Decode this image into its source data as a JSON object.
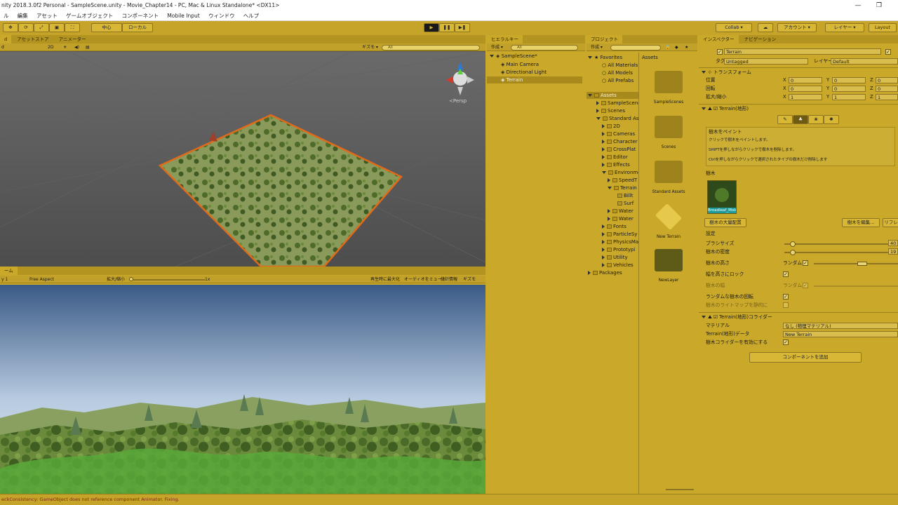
{
  "window": {
    "title": "nity 2018.3.0f2 Personal - SampleScene.unity - Movie_Chapter14 - PC, Mac & Linux Standalone* <DX11>",
    "minimize": "—",
    "restore": "❐"
  },
  "menu": [
    "ル",
    "編集",
    "アセット",
    "ゲームオブジェクト",
    "コンポーネント",
    "Mobile Input",
    "ウィンドウ",
    "ヘルプ"
  ],
  "toolbar": {
    "pivot": "中心",
    "space": "ローカル",
    "collab": "Collab ▾",
    "account": "アカウント ▾",
    "layers": "レイヤー ▾",
    "layout": "Layout"
  },
  "scene": {
    "tabs": [
      "d",
      "アセットストア",
      "アニメーター"
    ],
    "shaded": "d",
    "mode2d": "2D",
    "gizmos": "ギズモ ▾",
    "search": "All",
    "persp": "≺Persp"
  },
  "game": {
    "tab": "ーム",
    "display": "y 1",
    "aspect": "Free Aspect",
    "scale_label": "拡大/縮小",
    "scale_value": "1x",
    "maximize": "再生時に最大化",
    "mute": "オーディオをミュート",
    "stats": "統計情報",
    "gizmos": "ギズモ"
  },
  "hierarchy": {
    "tab": "ヒエラルキー",
    "create": "作成 ▾",
    "search": "All",
    "scene": "SampleScene*",
    "items": [
      "Main Camera",
      "Directional Light",
      "Terrain"
    ]
  },
  "project": {
    "tab": "プロジェクト",
    "create": "作成 ▾",
    "favorites": "Favorites",
    "fav_items": [
      "All Materials",
      "All Models",
      "All Prefabs"
    ],
    "assets_root": "Assets",
    "tree": [
      "SampleScene",
      "Scenes",
      "Standard As",
      "2D",
      "Cameras",
      "Character",
      "CrossPlat",
      "Editor",
      "Effects",
      "Environme",
      "SpeedT",
      "Terrain",
      "Billt",
      "Surf",
      "Water",
      "Water",
      "Fonts",
      "ParticleSy",
      "PhysicsMa",
      "Prototypi",
      "Utility",
      "Vehicles"
    ],
    "packages": "Packages",
    "breadcrumb": "Assets",
    "assets": [
      "SampleScenes",
      "Scenes",
      "Standard Assets",
      "New Terrain",
      "NewLayer"
    ]
  },
  "inspector": {
    "tab": "インスペクター",
    "tab2": "ナビゲーション",
    "object": "Terrain",
    "tag_label": "タグ",
    "tag": "Untagged",
    "layer_label": "レイヤー",
    "layer": "Default",
    "transform": {
      "title": "トランスフォーム",
      "pos": "位置",
      "rot": "回転",
      "scale": "拡大/縮小",
      "x": "X",
      "y": "Y",
      "z": "Z",
      "pos_v": [
        "0",
        "0",
        "0"
      ],
      "rot_v": [
        "0",
        "0",
        "0"
      ],
      "scale_v": [
        "1",
        "1",
        "1"
      ]
    },
    "terrain": {
      "title": "Terrain(地形)",
      "help_title": "樹木をペイント",
      "help1": "クリックで樹木をペイントします。",
      "help2": "SHIFTを押しながらクリックで樹木を削除します。",
      "help3": "Ctrlを押しながらクリックで選択されたタイプの樹木だけ削除します",
      "trees_label": "樹木",
      "tree_name": "Broadleaf_Mobi",
      "mass_place": "樹木の大量配置",
      "edit_trees": "樹木を編集...",
      "refresh": "リフレ",
      "settings": "設定",
      "brush_size": "ブラシサイズ",
      "brush_size_v": "40",
      "density": "樹木の密度",
      "density_v": "19",
      "height": "樹木の高さ",
      "random": "ランダム",
      "lock_width": "幅を高さにロック",
      "width": "樹木の幅",
      "random_rot": "ランダムな樹木の回転",
      "lightmap": "樹木のライトマップを静的に"
    },
    "collider": {
      "title": "Terrain(地形)コライダー",
      "material": "マテリアル",
      "material_v": "なし (物理マテリアル)",
      "data": "Terrain(地形)データ",
      "data_v": "New Terrain",
      "enable_trees": "樹木コライダーを有効にする"
    },
    "add_component": "コンポーネントを追加"
  },
  "status": "eckConsistency: GameObject does not reference component Animator. Fixing."
}
